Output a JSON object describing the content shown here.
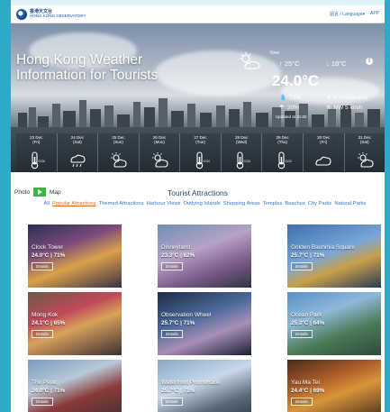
{
  "header": {
    "logo_zh": "香港天文台",
    "logo_en": "HONG KONG OBSERVATORY",
    "language_link": "語言 / Language▾",
    "app_link": "APP"
  },
  "hero": {
    "title_line1": "Hong Kong Weather",
    "title_line2": "Information for Tourists"
  },
  "current": {
    "date_label": "Now",
    "high": "25°C",
    "low": "18°C",
    "temperature": "24.0°C",
    "humidity": "71%",
    "uv": "5 (moderate)",
    "rain": "20%",
    "wind": "NW 5 km/h",
    "updated": "Updated at 21:00"
  },
  "forecast": [
    {
      "date": "23 Dec",
      "dow": "(Fri)",
      "icon": "thermometer-icon",
      "badge": "COOL",
      "temp": "17-21°C",
      "hum": "60-85%"
    },
    {
      "date": "24 Dec",
      "dow": "(Sat)",
      "icon": "cloud-rain-icon",
      "badge": "",
      "temp": "18-20°C",
      "hum": "80-95%"
    },
    {
      "date": "25 Dec",
      "dow": "(Sun)",
      "icon": "sun-cloud-icon",
      "badge": "",
      "temp": "19-22°C",
      "hum": "70-85%"
    },
    {
      "date": "26 Dec",
      "dow": "(Mon)",
      "icon": "sun-cloud-icon",
      "badge": "",
      "temp": "19-22°C",
      "hum": "65-80%"
    },
    {
      "date": "27 Dec",
      "dow": "(Tue)",
      "icon": "thermometer-icon",
      "badge": "COOL",
      "temp": "15-20°C",
      "hum": "75-90%"
    },
    {
      "date": "28 Dec",
      "dow": "(Wed)",
      "icon": "thermometer-icon",
      "badge": "COLD",
      "temp": "12-15°C",
      "hum": "80-95%"
    },
    {
      "date": "29 Dec",
      "dow": "(Thu)",
      "icon": "thermometer-icon",
      "badge": "COOL",
      "temp": "12-16°C",
      "hum": "75-90%"
    },
    {
      "date": "30 Dec",
      "dow": "(Fri)",
      "icon": "cloud-icon",
      "badge": "",
      "temp": "13-16°C",
      "hum": "75-90%"
    },
    {
      "date": "31 Dec",
      "dow": "(Sat)",
      "icon": "sun-cloud-icon",
      "badge": "",
      "temp": "14-18°C",
      "hum": "65-85%"
    }
  ],
  "attractions": {
    "photo_label": "Photo",
    "map_label": "Map",
    "title": "Tourist Attractions",
    "filters": [
      "All",
      "Popular Attractions",
      "Themed Attractions",
      "Harbour Views",
      "Outlying Islands",
      "Shopping Areas",
      "Temples",
      "Beaches",
      "City Parks",
      "Natural Parks"
    ],
    "active_filter": "Popular Attractions",
    "details_label": "Details",
    "cards": [
      {
        "name": "Clock Tower",
        "stat": "24.0°C | 71%",
        "bg": "linear-gradient(160deg,#2a2f55 0%,#7b4a7a 35%,#d9a14a 60%,#3d2f45 100%)"
      },
      {
        "name": "Disneyland",
        "stat": "23.3°C | 62%",
        "bg": "linear-gradient(160deg,#6f8fb8 0%,#b7a2c7 40%,#7a5a8a 70%,#2f3540 100%)"
      },
      {
        "name": "Golden Bauhinia Square",
        "stat": "25.7°C | 71%",
        "bg": "linear-gradient(160deg,#3c6fb0 0%,#7aa6d8 45%,#c8a04a 65%,#2b3a55 100%)"
      },
      {
        "name": "Mong Kok",
        "stat": "24.1°C | 65%",
        "bg": "linear-gradient(160deg,#6b5a4a 0%,#c0485a 35%,#d8a25a 55%,#3a2f35 100%)"
      },
      {
        "name": "Observation Wheel",
        "stat": "25.7°C | 71%",
        "bg": "linear-gradient(160deg,#1f2a45 0%,#4b6a9a 40%,#a88fb8 65%,#1a1f30 100%)"
      },
      {
        "name": "Ocean Park",
        "stat": "25.3°C | 64%",
        "bg": "linear-gradient(160deg,#5a8fc8 0%,#8fb8d8 35%,#4a7a55 65%,#2f4a3a 100%)"
      },
      {
        "name": "The Peak",
        "stat": "24.0°C | 71%",
        "bg": "linear-gradient(160deg,#7a9ac0 0%,#b8c8d8 35%,#8a3a3a 60%,#3a3030 100%)"
      },
      {
        "name": "Waterfront Promenade",
        "stat": "25.7°C | 71%",
        "bg": "linear-gradient(160deg,#8aa8c8 0%,#c8d8e8 40%,#5a6a7a 70%,#2a3440 100%)"
      },
      {
        "name": "Yau Ma Tei",
        "stat": "24.4°C | 69%",
        "bg": "linear-gradient(160deg,#4a2a1a 0%,#b0602a 35%,#d8953a 55%,#3a2418 100%)"
      }
    ]
  },
  "colors": {
    "accent_green": "#3eb34c",
    "link_blue": "#2f78c4",
    "active_orange": "#e06a26",
    "title_navy": "#2a4a70"
  }
}
